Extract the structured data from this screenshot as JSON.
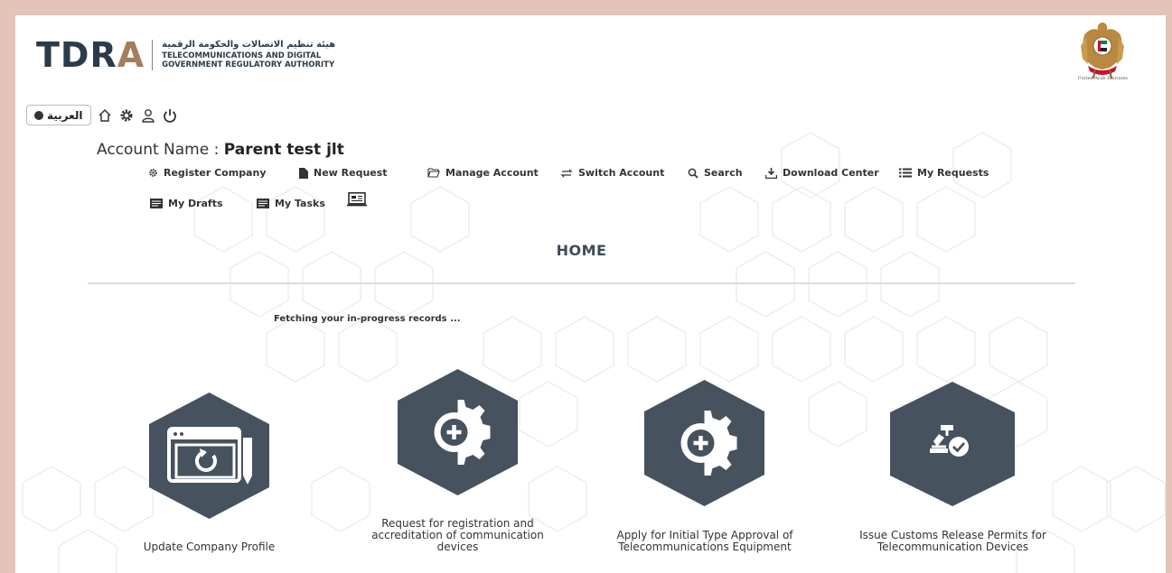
{
  "header": {
    "logo_text": "TDRA",
    "logo_arabic": "هيئة تنظيم الاتصالات والحكومة الرقمية",
    "logo_english_line1": "TELECOMMUNICATIONS AND DIGITAL",
    "logo_english_line2": "GOVERNMENT REGULATORY AUTHORITY",
    "emblem_caption": "United Arab Emirates"
  },
  "toolbar": {
    "language_label": "العربية",
    "icons": [
      "home-icon",
      "settings-icon",
      "user-icon",
      "power-icon"
    ]
  },
  "account": {
    "label": "Account Name : ",
    "name": "Parent test jlt"
  },
  "menu": {
    "register_company": "Register Company",
    "new_request": "New Request",
    "manage_account": "Manage Account",
    "switch_account": "Switch Account",
    "search": "Search",
    "download_center": "Download Center",
    "my_requests": "My Requests",
    "my_drafts": "My Drafts",
    "my_tasks": "My Tasks"
  },
  "main": {
    "title": "HOME",
    "status": "Fetching your in-progress records ..."
  },
  "services": {
    "update_profile": "Update Company Profile",
    "registration_line1": "Request for registration and",
    "registration_line2": "accreditation of communication",
    "registration_line3": "devices",
    "type_approval_line1": "Apply for Initial Type Approval of",
    "type_approval_line2": "Telecommunications Equipment",
    "customs_line1": "Issue Customs Release Permits for",
    "customs_line2": "Telecommunication Devices"
  },
  "colors": {
    "frame": "#e2c5b7",
    "hex_tile": "#46525e",
    "brand_dark": "#2b3b49",
    "brand_gold": "#a47d5a"
  }
}
